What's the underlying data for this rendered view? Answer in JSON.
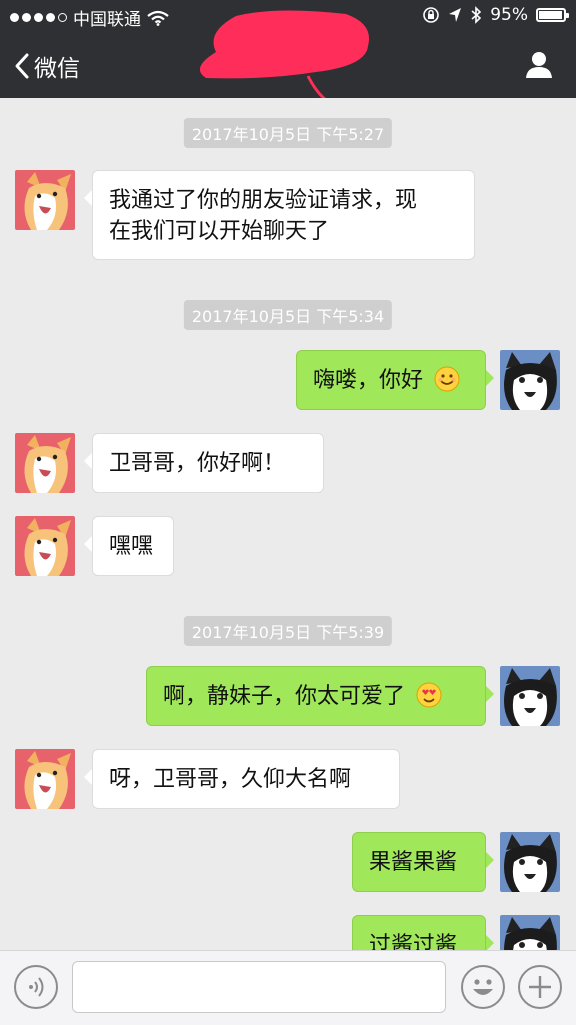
{
  "status_bar": {
    "carrier": "中国联通",
    "battery": "95%",
    "battery_level": 0.95,
    "icons": [
      "wifi-icon",
      "lock-rotation-icon",
      "location-arrow-icon",
      "bluetooth-icon",
      "battery-icon"
    ]
  },
  "nav": {
    "back_label": "微信",
    "title_redacted": true,
    "icons": [
      "back-chevron-icon",
      "profile-icon"
    ]
  },
  "messages": [
    {
      "type": "timestamp",
      "text": "2017年10月5日 下午5:27"
    },
    {
      "type": "incoming",
      "lines": [
        "我通过了你的朋友验证请求，现",
        "在我们可以开始聊天了"
      ],
      "avatar": "corgi-avatar"
    },
    {
      "type": "timestamp",
      "text": "2017年10月5日 下午5:34"
    },
    {
      "type": "outgoing",
      "text": "嗨喽，你好",
      "emoji": "smile-emoji",
      "avatar": "husky-avatar"
    },
    {
      "type": "incoming",
      "text": "卫哥哥，你好啊！",
      "avatar": "corgi-avatar"
    },
    {
      "type": "incoming",
      "text": "嘿嘿",
      "avatar": "corgi-avatar"
    },
    {
      "type": "timestamp",
      "text": "2017年10月5日 下午5:39"
    },
    {
      "type": "outgoing",
      "text": "啊，静妹子，你太可爱了",
      "emoji": "heart-eyes-emoji",
      "avatar": "husky-avatar"
    },
    {
      "type": "incoming",
      "text": "呀，卫哥哥，久仰大名啊",
      "avatar": "corgi-avatar"
    },
    {
      "type": "outgoing",
      "text": "果酱果酱",
      "avatar": "husky-avatar"
    },
    {
      "type": "outgoing",
      "text": "过酱过酱",
      "avatar": "husky-avatar",
      "partially_visible": true
    }
  ],
  "input_bar": {
    "text_value": "",
    "icons": [
      "voice-icon",
      "emoji-icon",
      "plus-icon"
    ]
  },
  "colors": {
    "nav_bg": "#2f3033",
    "chat_bg": "#ebebeb",
    "outgoing_bubble": "#a0e75a",
    "incoming_bubble": "#ffffff",
    "timestamp_bg": "#cfcfcf",
    "redaction": "#ff2d5a"
  }
}
